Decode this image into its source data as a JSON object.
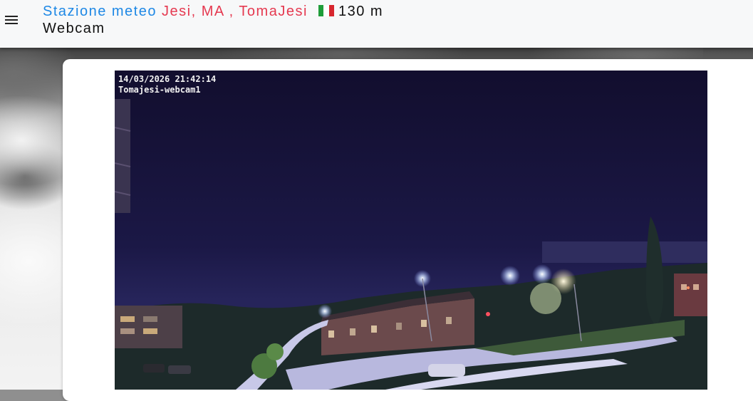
{
  "header": {
    "station_prefix": "Stazione meteo",
    "location": "Jesi, MA , TomaJesi",
    "flag_icon": "italy-flag-icon",
    "altitude": "130 m",
    "subtitle": "Webcam",
    "menu_icon": "hamburger-menu-icon"
  },
  "webcam": {
    "timestamp": "14/03/2026 21:42:14",
    "camera_name": "Tomajesi-webcam1"
  },
  "colors": {
    "station_text": "#1e88e5",
    "location_text": "#e53950",
    "appbar_bg": "#f7f8f9"
  }
}
